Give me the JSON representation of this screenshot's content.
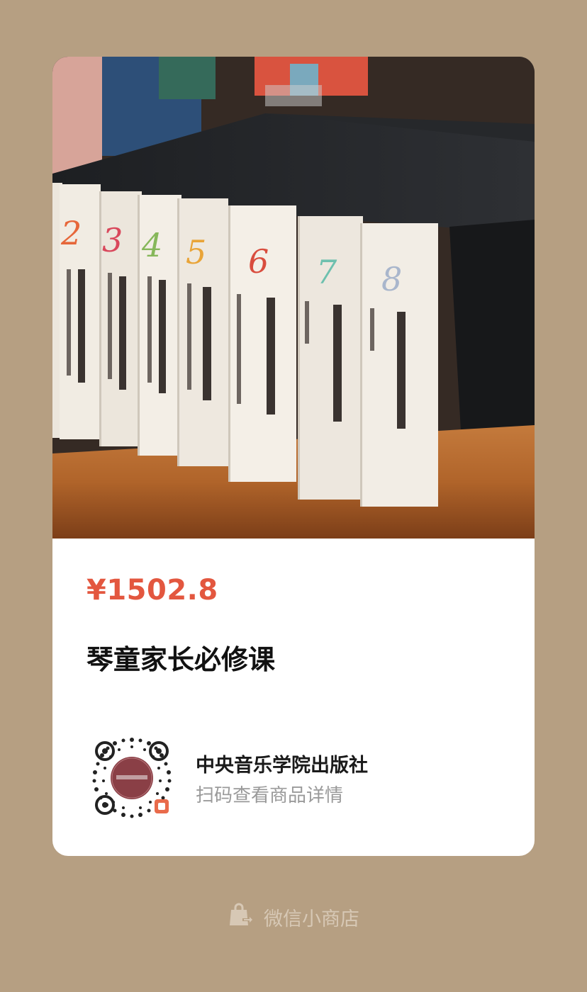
{
  "product": {
    "image_alt": "琴童家长必修课 boxed book set photo",
    "price": "¥1502.8",
    "title": "琴童家长必修课"
  },
  "shop": {
    "name": "中央音乐学院出版社",
    "scan_tip": "扫码查看商品详情"
  },
  "footer": {
    "icon": "shopping-bag-icon",
    "label": "微信小商店"
  },
  "colors": {
    "background": "#b69f82",
    "price": "#e3573f",
    "footer_text": "#d7c8b5"
  }
}
